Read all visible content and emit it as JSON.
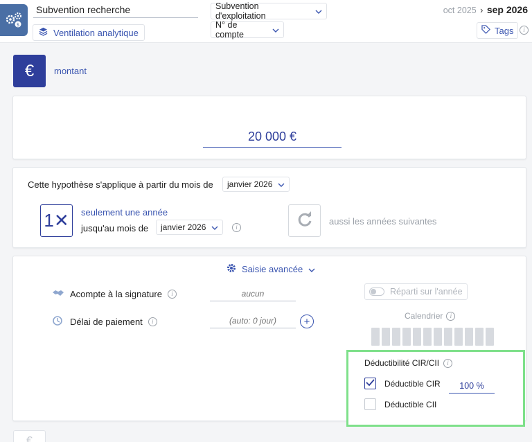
{
  "header": {
    "title_value": "Subvention recherche",
    "ventilation_label": "Ventilation analytique",
    "subvention_dropdown": "Subvention d'exploitation",
    "compte_dropdown": "N° de compte",
    "period_start": "oct 2025",
    "period_sep": "›",
    "period_end": "sep 2026",
    "tags_label": "Tags",
    "info_glyph": "i"
  },
  "montant": {
    "icon": "€",
    "label": "montant",
    "amount_value": "20 000 €"
  },
  "hypothese": {
    "text": "Cette hypothèse s'applique à partir du mois de",
    "start_month": "janvier 2026",
    "once_icon": "1✕",
    "once_label": "seulement une année",
    "until_label": "jusqu'au mois de",
    "end_month": "janvier 2026",
    "repeat_label": "aussi les années suivantes",
    "info_glyph": "i"
  },
  "advanced": {
    "toggle_label": "Saisie avancée",
    "acompte_label": "Acompte à la signature",
    "acompte_placeholder": "aucun",
    "delai_label": "Délai de paiement",
    "delai_placeholder": "(auto: 0 jour)",
    "plus_glyph": "+",
    "reparti_label": "Réparti sur l'année",
    "calendrier_label": "Calendrier",
    "calendar_bar_count": 12,
    "info_glyph": "i"
  },
  "cir_cii": {
    "title": "Déductibilité CIR/CII",
    "cir_label": "Déductible CIR",
    "cir_checked": true,
    "cir_percent": "100 %",
    "cii_label": "Déductible CII",
    "cii_checked": false,
    "info_glyph": "i"
  },
  "bottom": {
    "icon": "€"
  },
  "colors": {
    "accent": "#2e3e9b",
    "link": "#3a55b0",
    "highlight_border": "#7ee08a",
    "app_icon_bg": "#4a6fa5"
  }
}
